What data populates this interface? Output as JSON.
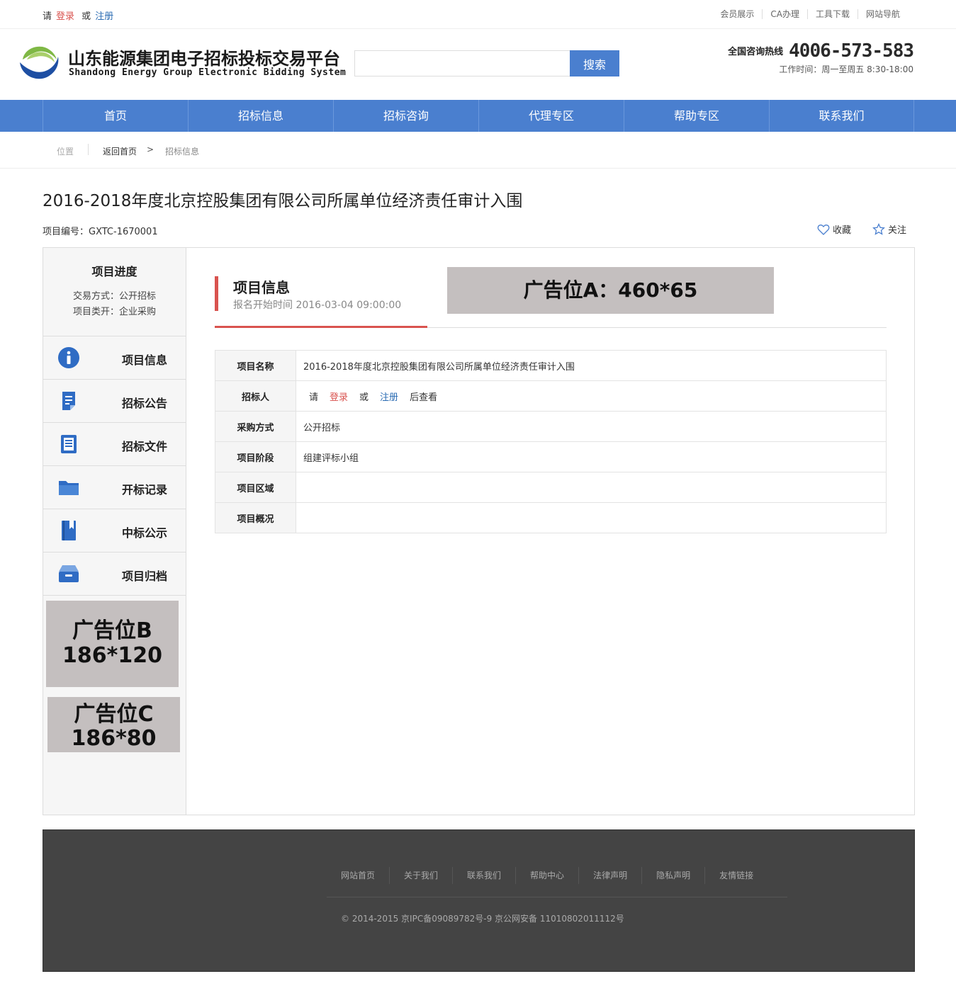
{
  "topbar": {
    "please": "请",
    "login": "登录",
    "or": "或",
    "register": "注册",
    "links": [
      "会员展示",
      "CA办理",
      "工具下载",
      "网站导航"
    ]
  },
  "header": {
    "logo_cn": "山东能源集团电子招标投标交易平台",
    "logo_en": "Shandong Energy Group Electronic Bidding System",
    "search_value": "",
    "search_button": "搜索",
    "hotline_label": "全国咨询热线",
    "hotline_number": "4006-573-583",
    "hours": "工作时间：周一至周五 8:30-18:00"
  },
  "nav": [
    "首页",
    "招标信息",
    "招标咨询",
    "代理专区",
    "帮助专区",
    "联系我们"
  ],
  "breadcrumb": {
    "position": "位置",
    "home": "返回首页",
    "arrow": ">",
    "current": "招标信息"
  },
  "page": {
    "title": "2016-2018年度北京控股集团有限公司所属单位经济责任审计入围",
    "project_no": "项目编号：GXTC-1670001",
    "favorite": "收藏",
    "follow": "关注"
  },
  "sidebar": {
    "progress_title": "项目进度",
    "trade_mode": "交易方式：公开招标",
    "category": "项目类开：企业采购",
    "items": [
      {
        "label": "项目信息",
        "icon": "info-icon"
      },
      {
        "label": "招标公告",
        "icon": "document-icon"
      },
      {
        "label": "招标文件",
        "icon": "file-list-icon"
      },
      {
        "label": "开标记录",
        "icon": "folder-icon"
      },
      {
        "label": "中标公示",
        "icon": "book-icon"
      },
      {
        "label": "项目归档",
        "icon": "archive-box-icon"
      }
    ],
    "adB_line1": "广告位B",
    "adB_line2": "186*120",
    "adC_line1": "广告位C",
    "adC_line2": "186*80"
  },
  "content": {
    "section_title": "项目信息",
    "section_sub": "报名开始时间 2016-03-04 09:00:00",
    "adA": "广告位A：460*65",
    "rows": [
      {
        "key": "项目名称",
        "value": "2016-2018年度北京控股集团有限公司所属单位经济责任审计入围"
      },
      {
        "key": "招标人",
        "please": "请",
        "login": "登录",
        "or": "或",
        "register": "注册",
        "after": "后查看"
      },
      {
        "key": "采购方式",
        "value": "公开招标"
      },
      {
        "key": "项目阶段",
        "value": "组建评标小组"
      },
      {
        "key": "项目区域",
        "value": ""
      },
      {
        "key": "项目概况",
        "value": ""
      }
    ]
  },
  "footer": {
    "links": [
      "网站首页",
      "关于我们",
      "联系我们",
      "帮助中心",
      "法律声明",
      "隐私声明",
      "友情链接"
    ],
    "copyright": "© 2014-2015 京IPC备09089782号-9 京公网安备 11010802011112号"
  },
  "colors": {
    "primary": "#4a7fcf",
    "accent": "#d9534f",
    "footer": "#444444",
    "ad": "#c4bfbf"
  }
}
